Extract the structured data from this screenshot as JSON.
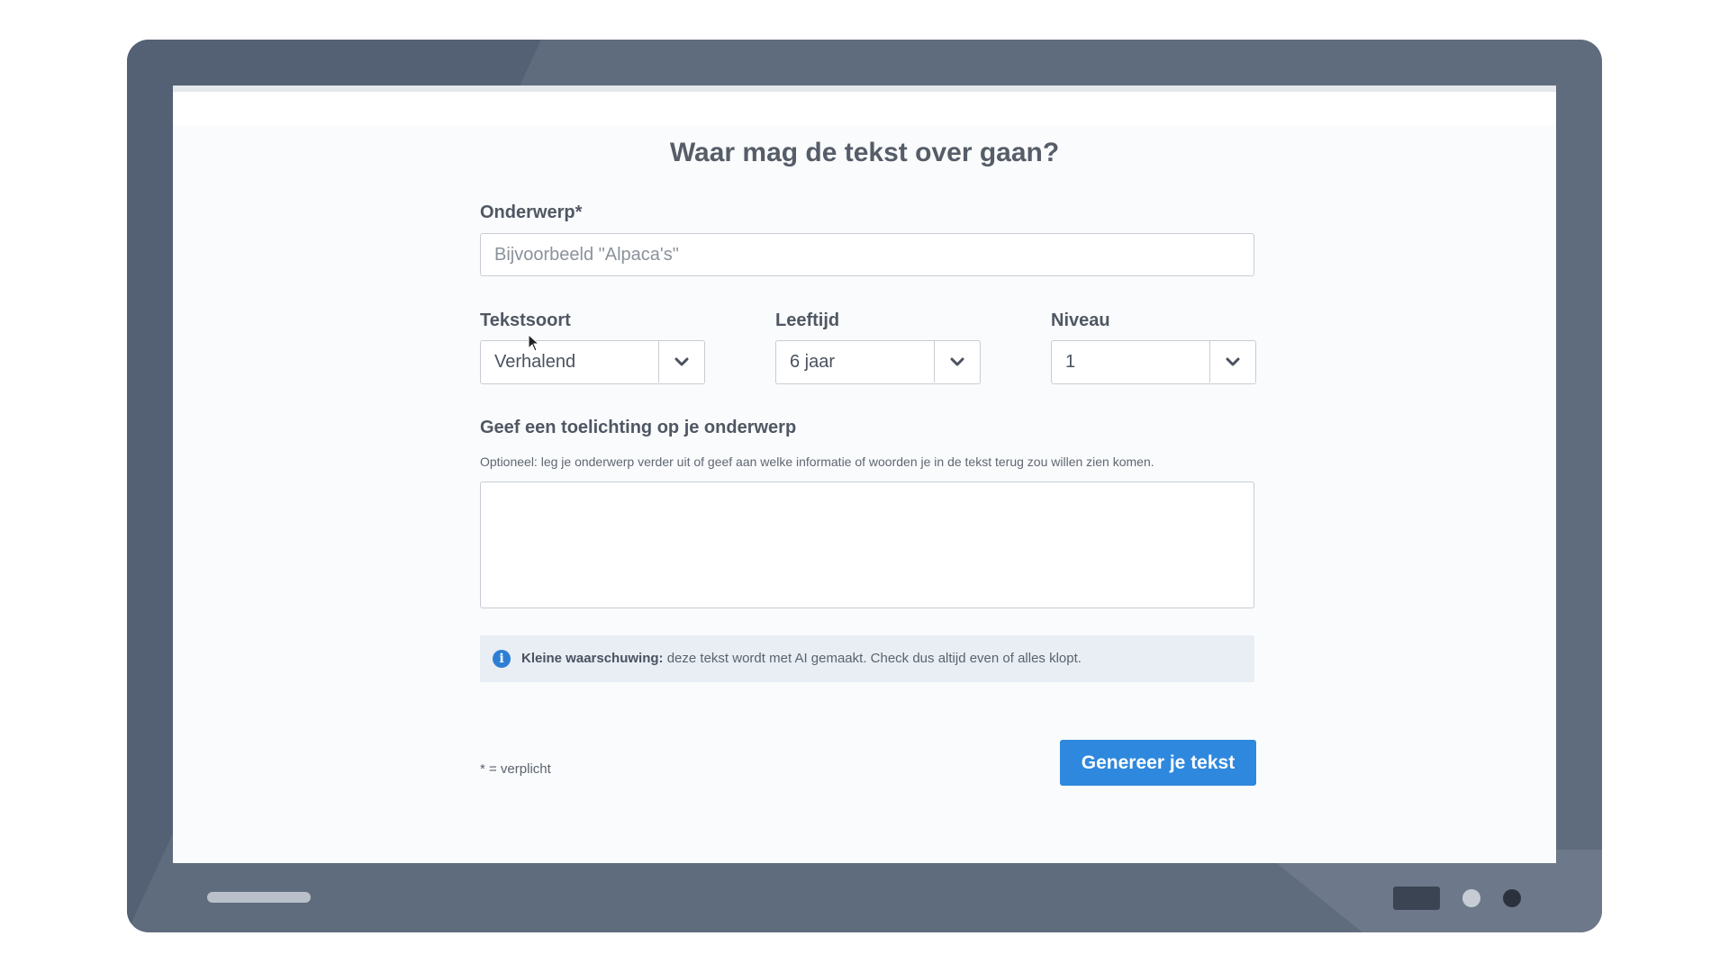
{
  "form": {
    "title": "Waar mag de tekst over gaan?",
    "subject": {
      "label": "Onderwerp*",
      "placeholder": "Bijvoorbeeld \"Alpaca's\"",
      "value": ""
    },
    "text_type": {
      "label": "Tekstsoort",
      "value": "Verhalend"
    },
    "age": {
      "label": "Leeftijd",
      "value": "6 jaar"
    },
    "level": {
      "label": "Niveau",
      "value": "1"
    },
    "explanation": {
      "label": "Geef een toelichting op je onderwerp",
      "hint": "Optioneel: leg je onderwerp verder uit of geef aan welke informatie of woorden je in de tekst terug zou willen zien komen.",
      "value": ""
    },
    "notice": {
      "icon": "info-icon",
      "bold": "Kleine waarschuwing:",
      "text": " deze tekst wordt met AI gemaakt. Check dus altijd even of alles klopt."
    },
    "required_note": "* = verplicht",
    "submit_label": "Genereer je tekst"
  },
  "colors": {
    "device_frame": "#5f6c7e",
    "primary_button": "#2e88dd",
    "info_icon": "#2e7fd3",
    "notice_background": "#e8eef4"
  }
}
